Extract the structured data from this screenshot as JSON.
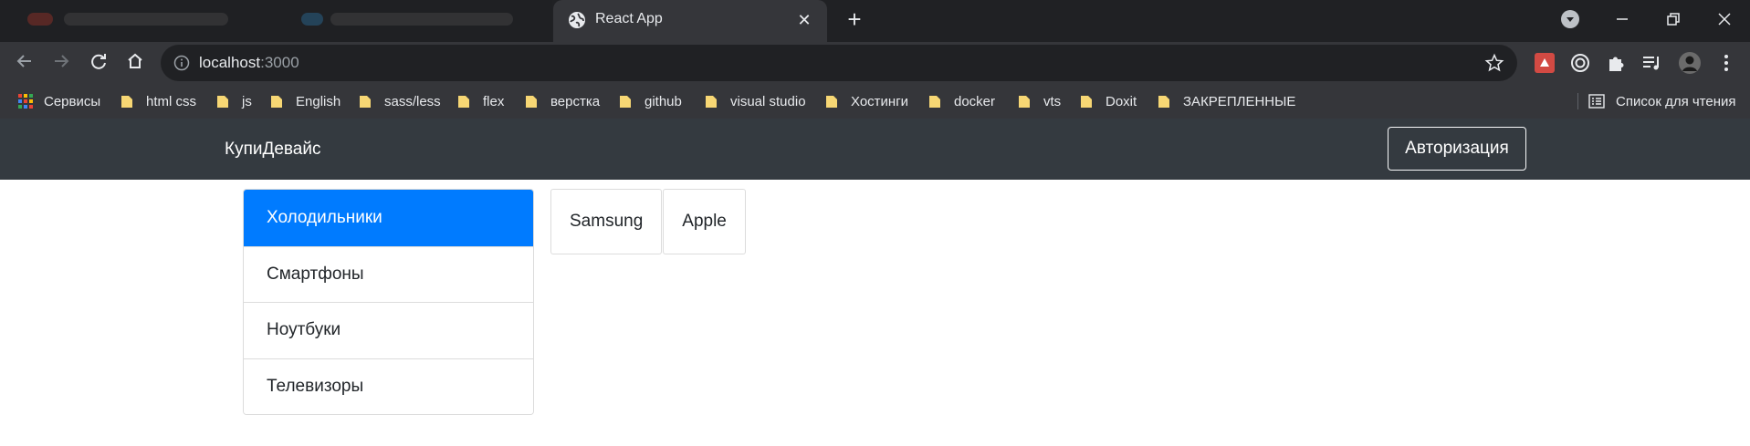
{
  "browser": {
    "tab": {
      "title": "React App",
      "close_glyph": "✕"
    },
    "new_tab_glyph": "+",
    "url": {
      "host": "localhost",
      "port": ":3000"
    },
    "bookmarks": [
      {
        "label": "Сервисы",
        "icon": "apps-grid-icon"
      },
      {
        "label": "html css",
        "icon": "folder-icon"
      },
      {
        "label": "js",
        "icon": "folder-icon"
      },
      {
        "label": "English",
        "icon": "folder-icon"
      },
      {
        "label": "sass/less",
        "icon": "folder-icon"
      },
      {
        "label": "flex",
        "icon": "folder-icon"
      },
      {
        "label": "верстка",
        "icon": "folder-icon"
      },
      {
        "label": "github",
        "icon": "folder-icon"
      },
      {
        "label": "visual studio",
        "icon": "folder-icon"
      },
      {
        "label": "Хостинги",
        "icon": "folder-icon"
      },
      {
        "label": "docker",
        "icon": "folder-icon"
      },
      {
        "label": "vts",
        "icon": "folder-icon"
      },
      {
        "label": "Doxit",
        "icon": "folder-icon"
      },
      {
        "label": "ЗАКРЕПЛЕННЫЕ",
        "icon": "folder-icon"
      }
    ],
    "reading_list": "Список для чтения"
  },
  "app": {
    "brand": "КупиДевайс",
    "auth_button": "Авторизация",
    "types": [
      {
        "label": "Холодильники",
        "active": true
      },
      {
        "label": "Смартфоны",
        "active": false
      },
      {
        "label": "Ноутбуки",
        "active": false
      },
      {
        "label": "Телевизоры",
        "active": false
      }
    ],
    "brands": [
      "Samsung",
      "Apple"
    ]
  },
  "colors": {
    "active_item": "#007bff",
    "navbar": "#343a40",
    "folder": "#f7d774"
  }
}
